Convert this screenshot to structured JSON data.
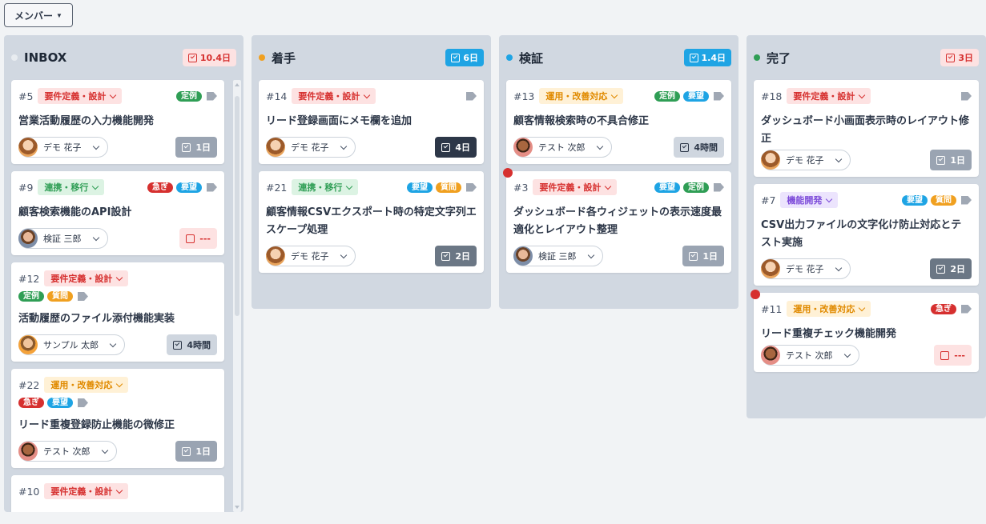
{
  "toolbar": {
    "member_label": "メンバー"
  },
  "columns": [
    {
      "title": "INBOX",
      "badge": "10.4日",
      "color": "#d1d8e1",
      "dot": "#e5e9ee"
    },
    {
      "title": "着手",
      "badge": "6日",
      "dot": "#f0a020"
    },
    {
      "title": "検証",
      "badge": "1.4日",
      "dot": "#1ea4e4"
    },
    {
      "title": "完了",
      "badge": "3日",
      "dot": "#2f9e55"
    }
  ],
  "cards": {
    "c5": {
      "num": "#5",
      "cat": "要件定義・設計",
      "tags": [
        "定例"
      ],
      "title": "営業活動履歴の入力機能開発",
      "assignee": "デモ 花子",
      "est": "1日"
    },
    "c9": {
      "num": "#9",
      "cat": "連携・移行",
      "tags": [
        "急ぎ",
        "要望"
      ],
      "title": "顧客検索機能のAPI設計",
      "assignee": "検証 三郎",
      "est": "---"
    },
    "c12": {
      "num": "#12",
      "cat": "要件定義・設計",
      "tags": [
        "定例",
        "質問"
      ],
      "title": "活動履歴のファイル添付機能実装",
      "assignee": "サンプル 太郎",
      "est": "4時間"
    },
    "c22": {
      "num": "#22",
      "cat": "運用・改善対応",
      "tags": [
        "急ぎ",
        "要望"
      ],
      "title": "リード重複登録防止機能の微修正",
      "assignee": "テスト 次郎",
      "est": "1日"
    },
    "c10": {
      "num": "#10",
      "cat": "要件定義・設計"
    },
    "c14": {
      "num": "#14",
      "cat": "要件定義・設計",
      "title": "リード登録画面にメモ欄を追加",
      "assignee": "デモ 花子",
      "est": "4日"
    },
    "c21": {
      "num": "#21",
      "cat": "連携・移行",
      "tags": [
        "要望",
        "質問"
      ],
      "title": "顧客情報CSVエクスポート時の特定文字列エスケープ処理",
      "assignee": "デモ 花子",
      "est": "2日"
    },
    "c13": {
      "num": "#13",
      "cat": "運用・改善対応",
      "tags": [
        "定例",
        "要望"
      ],
      "title": "顧客情報検索時の不具合修正",
      "assignee": "テスト 次郎",
      "est": "4時間"
    },
    "c3": {
      "num": "#3",
      "cat": "要件定義・設計",
      "tags": [
        "要望",
        "定例"
      ],
      "title": "ダッシュボード各ウィジェットの表示速度最適化とレイアウト整理",
      "assignee": "検証 三郎",
      "est": "1日"
    },
    "c18": {
      "num": "#18",
      "cat": "要件定義・設計",
      "title": "ダッシュボード小画面表示時のレイアウト修正",
      "assignee": "デモ 花子",
      "est": "1日"
    },
    "c7": {
      "num": "#7",
      "cat": "機能開発",
      "tags": [
        "要望",
        "質問"
      ],
      "title": "CSV出力ファイルの文字化け防止対応とテスト実施",
      "assignee": "デモ 花子",
      "est": "2日"
    },
    "c11": {
      "num": "#11",
      "cat": "運用・改善対応",
      "tags": [
        "急ぎ"
      ],
      "title": "リード重複チェック機能開発",
      "assignee": "テスト 次郎",
      "est": "---"
    }
  }
}
